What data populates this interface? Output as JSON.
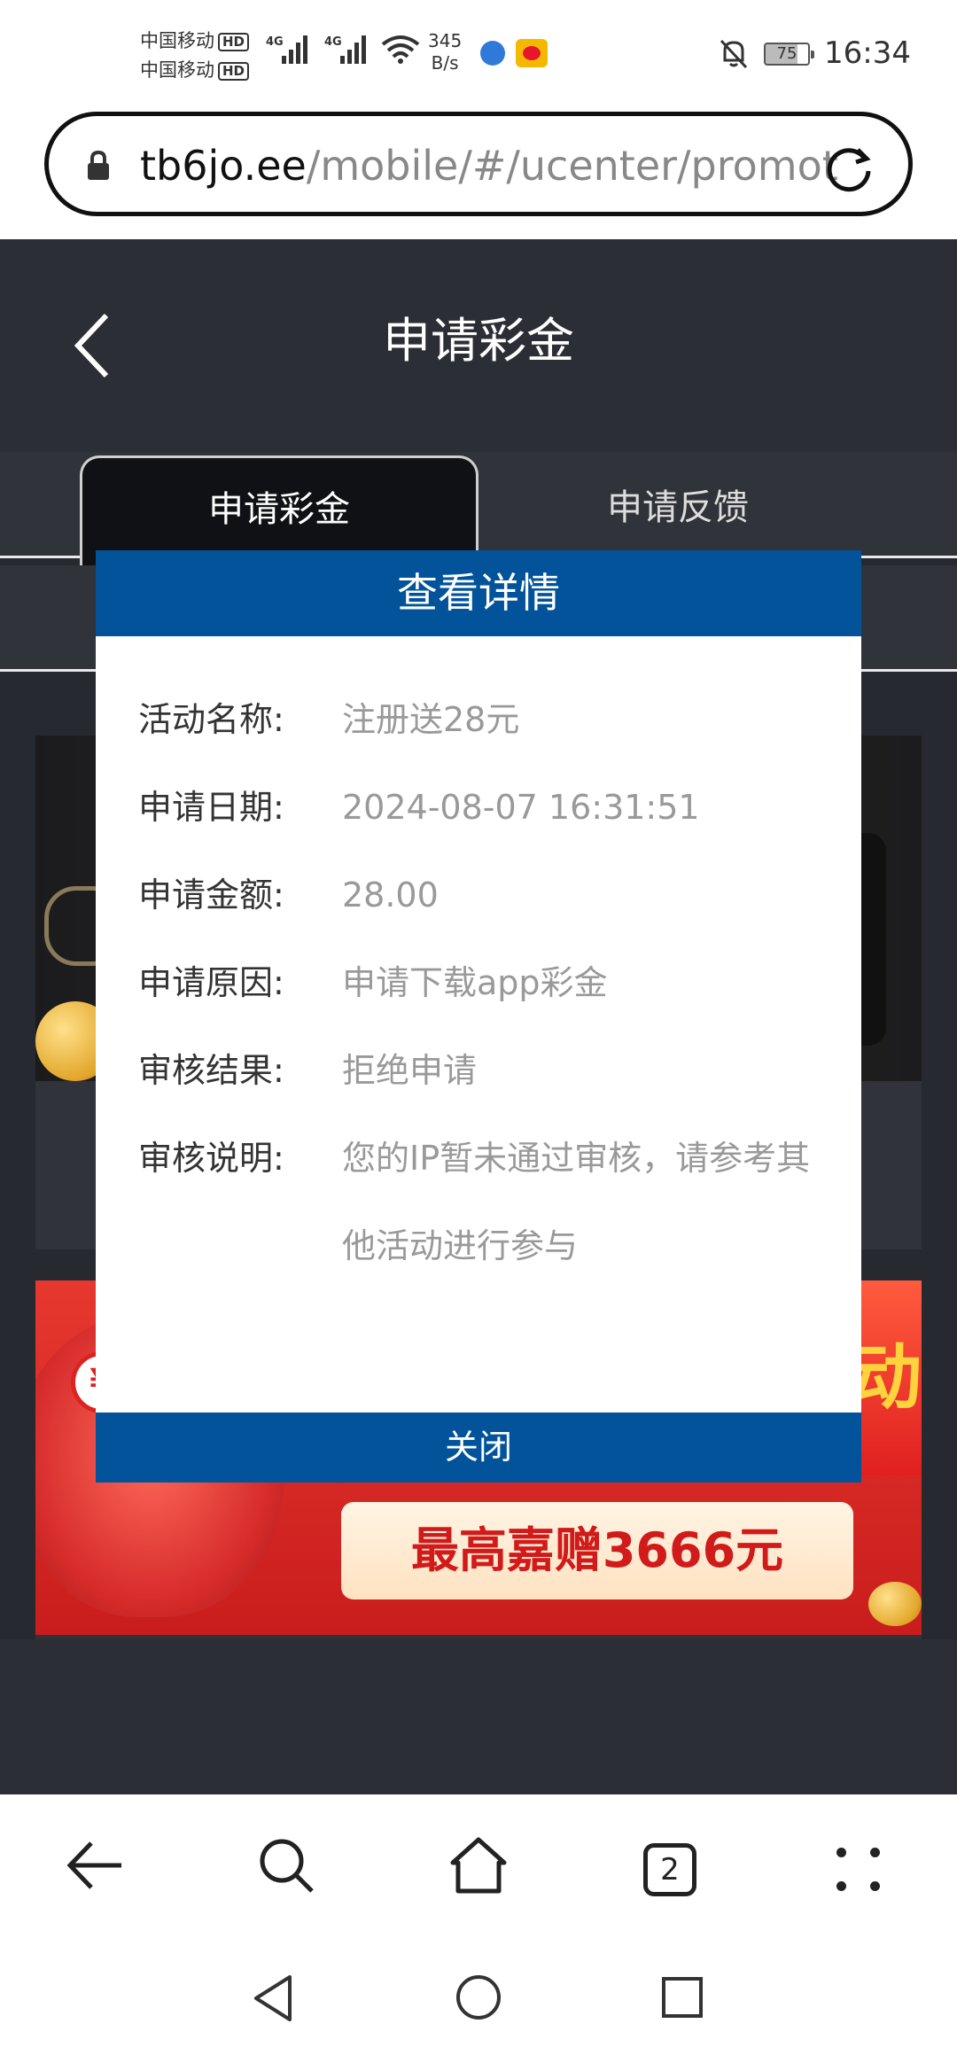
{
  "status_bar": {
    "carrier_1": "中国移动",
    "carrier_2": "中国移动",
    "hd_label": "HD",
    "network_type_1": "4G",
    "network_type_2": "4G",
    "net_speed_value": "345",
    "net_speed_unit": "B/s",
    "battery_level": "75",
    "time": "16:34"
  },
  "address_bar": {
    "domain": "tb6jo.ee",
    "path": "/mobile/#/ucenter/promot"
  },
  "page": {
    "title": "申请彩金",
    "tabs": [
      {
        "label": "申请彩金",
        "active": true
      },
      {
        "label": "申请反馈",
        "active": false
      }
    ],
    "banner_text": "最高嘉赠3666元",
    "banner_side_text": "动",
    "coin_symbol": "¥"
  },
  "modal": {
    "title": "查看详情",
    "rows": [
      {
        "label": "活动名称:",
        "value": "注册送28元"
      },
      {
        "label": "申请日期:",
        "value": "2024-08-07 16:31:51"
      },
      {
        "label": "申请金额:",
        "value": "28.00"
      },
      {
        "label": "申请原因:",
        "value": "申请下载app彩金"
      },
      {
        "label": "审核结果:",
        "value": "拒绝申请"
      },
      {
        "label": "审核说明:",
        "value": "您的IP暂未通过审核，请参考其他活动进行参与"
      }
    ],
    "close_label": "关闭"
  },
  "toolbar": {
    "tab_count": "2",
    "icons": [
      "back-arrow-icon",
      "search-icon",
      "home-icon",
      "tabs-icon",
      "more-icon"
    ]
  },
  "colors": {
    "header_bg": "#2b2e35",
    "modal_accent": "#02539a",
    "banner_red": "#d62b2b"
  }
}
